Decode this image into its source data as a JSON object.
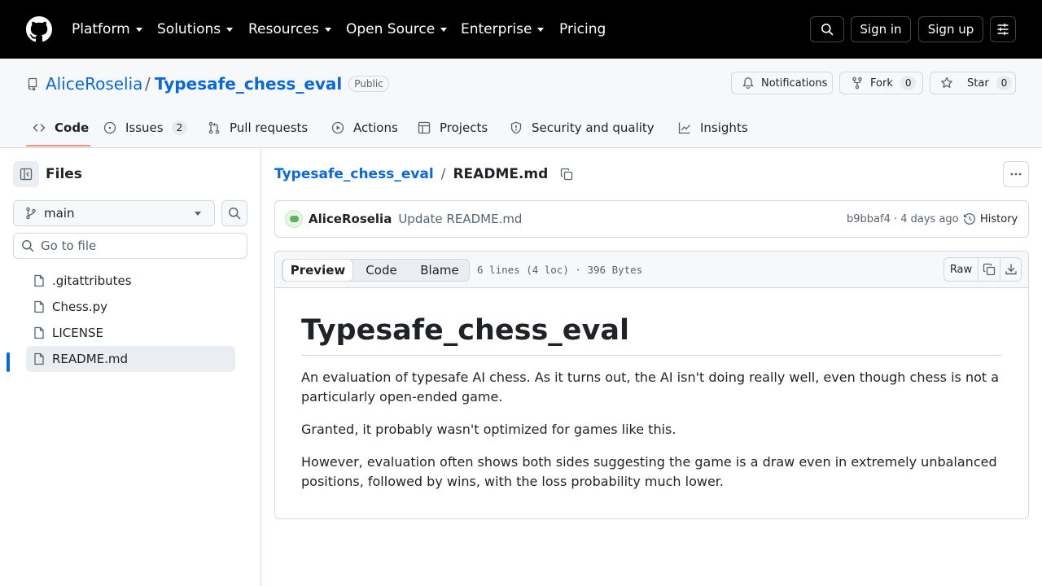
{
  "nav": {
    "items": [
      {
        "label": "Platform"
      },
      {
        "label": "Solutions"
      },
      {
        "label": "Resources"
      },
      {
        "label": "Open Source"
      },
      {
        "label": "Enterprise"
      },
      {
        "label": "Pricing"
      }
    ],
    "sign_in": "Sign in",
    "sign_up": "Sign up"
  },
  "repo": {
    "owner": "AliceRoselia",
    "separator": "/",
    "name": "Typesafe_chess_eval",
    "visibility": "Public",
    "notifications_label": "Notifications",
    "fork_label": "Fork",
    "fork_count": "0",
    "star_label": "Star",
    "star_count": "0"
  },
  "tabs": [
    {
      "label": "Code"
    },
    {
      "label": "Issues",
      "count": "2"
    },
    {
      "label": "Pull requests"
    },
    {
      "label": "Actions"
    },
    {
      "label": "Projects"
    },
    {
      "label": "Security and quality"
    },
    {
      "label": "Insights"
    }
  ],
  "sidebar": {
    "title": "Files",
    "branch": "main",
    "goto_placeholder": "Go to file",
    "files": [
      {
        "name": ".gitattributes"
      },
      {
        "name": "Chess.py"
      },
      {
        "name": "LICENSE"
      },
      {
        "name": "README.md",
        "active": true
      }
    ]
  },
  "breadcrumb": {
    "repo": "Typesafe_chess_eval",
    "separator": "/",
    "file": "README.md"
  },
  "commit": {
    "author": "AliceRoselia",
    "message": "Update README.md",
    "hash_age": "b9bbaf4 · 4 days ago",
    "history_label": "History"
  },
  "file_toolbar": {
    "preview": "Preview",
    "code": "Code",
    "blame": "Blame",
    "info": "6 lines (4 loc) · 396 Bytes",
    "raw": "Raw"
  },
  "readme": {
    "heading": "Typesafe_chess_eval",
    "p1": "An evaluation of typesafe AI chess. As it turns out, the AI isn't doing really well, even though chess is not a particularly open-ended game.",
    "p2": "Granted, it probably wasn't optimized for games like this.",
    "p3": "However, evaluation often shows both sides suggesting the game is a draw even in extremely unbalanced positions, followed by wins, with the loss probability much lower."
  },
  "colors": {
    "link": "#0969da",
    "active_indicator": "#0969da",
    "tab_underline": "#fd8c73",
    "nav_bg": "#000000"
  },
  "icons": {
    "logo": "github-mark-icon",
    "search": "search-icon",
    "menu": "sliders-icon",
    "repo": "repo-icon",
    "bell": "bell-icon",
    "fork": "fork-icon",
    "star": "star-icon",
    "file": "file-icon",
    "branch": "branch-icon",
    "copy": "copy-icon",
    "download": "download-icon",
    "history": "history-icon",
    "kebab": "kebab-icon"
  }
}
